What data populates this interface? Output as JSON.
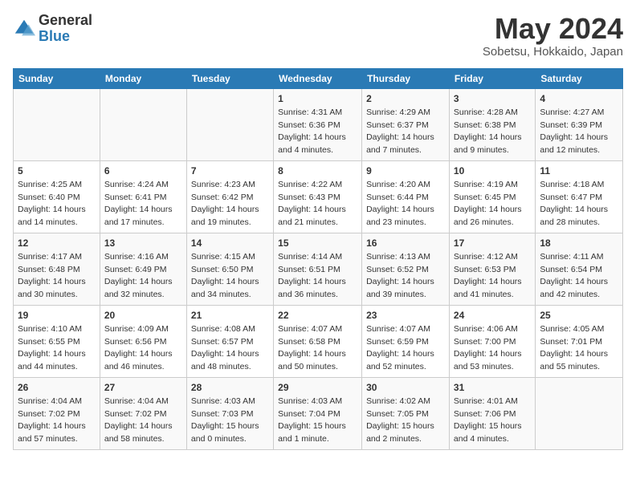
{
  "header": {
    "logo_line1": "General",
    "logo_line2": "Blue",
    "month_title": "May 2024",
    "location": "Sobetsu, Hokkaido, Japan"
  },
  "weekdays": [
    "Sunday",
    "Monday",
    "Tuesday",
    "Wednesday",
    "Thursday",
    "Friday",
    "Saturday"
  ],
  "weeks": [
    [
      {
        "day": "",
        "info": ""
      },
      {
        "day": "",
        "info": ""
      },
      {
        "day": "",
        "info": ""
      },
      {
        "day": "1",
        "info": "Sunrise: 4:31 AM\nSunset: 6:36 PM\nDaylight: 14 hours\nand 4 minutes."
      },
      {
        "day": "2",
        "info": "Sunrise: 4:29 AM\nSunset: 6:37 PM\nDaylight: 14 hours\nand 7 minutes."
      },
      {
        "day": "3",
        "info": "Sunrise: 4:28 AM\nSunset: 6:38 PM\nDaylight: 14 hours\nand 9 minutes."
      },
      {
        "day": "4",
        "info": "Sunrise: 4:27 AM\nSunset: 6:39 PM\nDaylight: 14 hours\nand 12 minutes."
      }
    ],
    [
      {
        "day": "5",
        "info": "Sunrise: 4:25 AM\nSunset: 6:40 PM\nDaylight: 14 hours\nand 14 minutes."
      },
      {
        "day": "6",
        "info": "Sunrise: 4:24 AM\nSunset: 6:41 PM\nDaylight: 14 hours\nand 17 minutes."
      },
      {
        "day": "7",
        "info": "Sunrise: 4:23 AM\nSunset: 6:42 PM\nDaylight: 14 hours\nand 19 minutes."
      },
      {
        "day": "8",
        "info": "Sunrise: 4:22 AM\nSunset: 6:43 PM\nDaylight: 14 hours\nand 21 minutes."
      },
      {
        "day": "9",
        "info": "Sunrise: 4:20 AM\nSunset: 6:44 PM\nDaylight: 14 hours\nand 23 minutes."
      },
      {
        "day": "10",
        "info": "Sunrise: 4:19 AM\nSunset: 6:45 PM\nDaylight: 14 hours\nand 26 minutes."
      },
      {
        "day": "11",
        "info": "Sunrise: 4:18 AM\nSunset: 6:47 PM\nDaylight: 14 hours\nand 28 minutes."
      }
    ],
    [
      {
        "day": "12",
        "info": "Sunrise: 4:17 AM\nSunset: 6:48 PM\nDaylight: 14 hours\nand 30 minutes."
      },
      {
        "day": "13",
        "info": "Sunrise: 4:16 AM\nSunset: 6:49 PM\nDaylight: 14 hours\nand 32 minutes."
      },
      {
        "day": "14",
        "info": "Sunrise: 4:15 AM\nSunset: 6:50 PM\nDaylight: 14 hours\nand 34 minutes."
      },
      {
        "day": "15",
        "info": "Sunrise: 4:14 AM\nSunset: 6:51 PM\nDaylight: 14 hours\nand 36 minutes."
      },
      {
        "day": "16",
        "info": "Sunrise: 4:13 AM\nSunset: 6:52 PM\nDaylight: 14 hours\nand 39 minutes."
      },
      {
        "day": "17",
        "info": "Sunrise: 4:12 AM\nSunset: 6:53 PM\nDaylight: 14 hours\nand 41 minutes."
      },
      {
        "day": "18",
        "info": "Sunrise: 4:11 AM\nSunset: 6:54 PM\nDaylight: 14 hours\nand 42 minutes."
      }
    ],
    [
      {
        "day": "19",
        "info": "Sunrise: 4:10 AM\nSunset: 6:55 PM\nDaylight: 14 hours\nand 44 minutes."
      },
      {
        "day": "20",
        "info": "Sunrise: 4:09 AM\nSunset: 6:56 PM\nDaylight: 14 hours\nand 46 minutes."
      },
      {
        "day": "21",
        "info": "Sunrise: 4:08 AM\nSunset: 6:57 PM\nDaylight: 14 hours\nand 48 minutes."
      },
      {
        "day": "22",
        "info": "Sunrise: 4:07 AM\nSunset: 6:58 PM\nDaylight: 14 hours\nand 50 minutes."
      },
      {
        "day": "23",
        "info": "Sunrise: 4:07 AM\nSunset: 6:59 PM\nDaylight: 14 hours\nand 52 minutes."
      },
      {
        "day": "24",
        "info": "Sunrise: 4:06 AM\nSunset: 7:00 PM\nDaylight: 14 hours\nand 53 minutes."
      },
      {
        "day": "25",
        "info": "Sunrise: 4:05 AM\nSunset: 7:01 PM\nDaylight: 14 hours\nand 55 minutes."
      }
    ],
    [
      {
        "day": "26",
        "info": "Sunrise: 4:04 AM\nSunset: 7:02 PM\nDaylight: 14 hours\nand 57 minutes."
      },
      {
        "day": "27",
        "info": "Sunrise: 4:04 AM\nSunset: 7:02 PM\nDaylight: 14 hours\nand 58 minutes."
      },
      {
        "day": "28",
        "info": "Sunrise: 4:03 AM\nSunset: 7:03 PM\nDaylight: 15 hours\nand 0 minutes."
      },
      {
        "day": "29",
        "info": "Sunrise: 4:03 AM\nSunset: 7:04 PM\nDaylight: 15 hours\nand 1 minute."
      },
      {
        "day": "30",
        "info": "Sunrise: 4:02 AM\nSunset: 7:05 PM\nDaylight: 15 hours\nand 2 minutes."
      },
      {
        "day": "31",
        "info": "Sunrise: 4:01 AM\nSunset: 7:06 PM\nDaylight: 15 hours\nand 4 minutes."
      },
      {
        "day": "",
        "info": ""
      }
    ]
  ]
}
